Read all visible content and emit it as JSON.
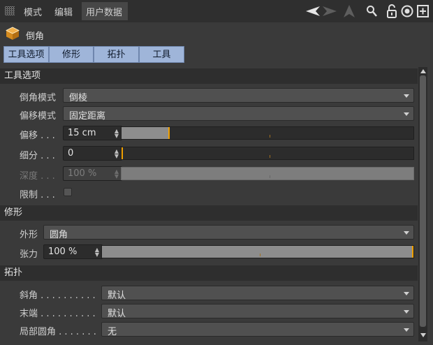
{
  "menubar": {
    "items": [
      "模式",
      "编辑",
      "用户数据"
    ]
  },
  "toolbar_icons": [
    "back-arrow-icon",
    "forward-arrow-icon",
    "up-arrow-icon",
    "search-icon",
    "lock-icon",
    "target-icon",
    "add-panel-icon"
  ],
  "object": {
    "title": "倒角",
    "icon": "bevel-cube-icon"
  },
  "tabs": [
    "工具选项",
    "修形",
    "拓扑",
    "工具"
  ],
  "sections": {
    "tool_options": {
      "heading": "工具选项",
      "bevel_mode": {
        "label": "倒角模式",
        "value": "倒棱"
      },
      "offset_mode": {
        "label": "偏移模式",
        "value": "固定距离"
      },
      "offset": {
        "label": "偏移 . . .",
        "value": "15 cm",
        "slider_fraction": 0.16
      },
      "subdivision": {
        "label": "细分 . . .",
        "value": "0",
        "slider_fraction": 0.0
      },
      "depth": {
        "label": "深度 . . .",
        "value": "100 %",
        "disabled": true
      },
      "limit": {
        "label": "限制 . . .",
        "checked": false
      }
    },
    "shaping": {
      "heading": "修形",
      "shape": {
        "label": "外形",
        "value": "圆角"
      },
      "tension": {
        "label": "张力",
        "value": "100 %",
        "slider_fraction": 1.0
      }
    },
    "topology": {
      "heading": "拓扑",
      "miter": {
        "label": "斜角 . . . . . . . . . .",
        "value": "默认"
      },
      "end": {
        "label": "末端 . . . . . . . . . .",
        "value": "默认"
      },
      "partial_rounding": {
        "label": "局部圆角 . . . . . . .",
        "value": "无"
      }
    }
  },
  "colors": {
    "tab_bg": "#9fb5d9",
    "knob": "#f0a000",
    "panel_bg": "#3a3a3a",
    "section_bg": "#2e2e2e"
  }
}
